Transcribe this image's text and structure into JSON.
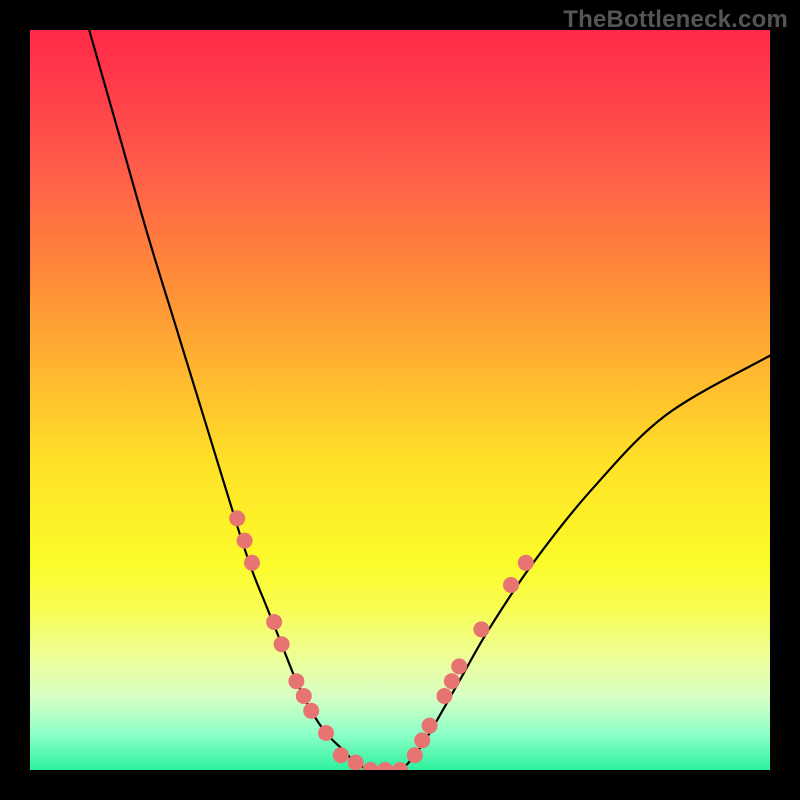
{
  "watermark": "TheBottleneck.com",
  "colors": {
    "background": "#000000",
    "dot": "#e77470",
    "curve": "#000000"
  },
  "chart_data": {
    "type": "line",
    "title": "",
    "xlabel": "",
    "ylabel": "",
    "xlim": [
      0,
      100
    ],
    "ylim": [
      0,
      100
    ],
    "grid": false,
    "legend": false,
    "series": [
      {
        "name": "bottleneck-curve",
        "x": [
          8,
          12,
          16,
          20,
          24,
          28,
          30,
          32,
          34,
          36,
          38,
          40,
          42,
          44,
          46,
          48,
          50,
          52,
          54,
          58,
          62,
          68,
          76,
          86,
          100
        ],
        "values": [
          100,
          86,
          72,
          59,
          46,
          33,
          27,
          22,
          17,
          12,
          8,
          5,
          3,
          1,
          0,
          0,
          0,
          2,
          5,
          12,
          19,
          28,
          38,
          48,
          56
        ]
      }
    ],
    "annotations": {
      "scatter_points": [
        {
          "x": 28,
          "y": 34
        },
        {
          "x": 29,
          "y": 31
        },
        {
          "x": 30,
          "y": 28
        },
        {
          "x": 33,
          "y": 20
        },
        {
          "x": 34,
          "y": 17
        },
        {
          "x": 36,
          "y": 12
        },
        {
          "x": 37,
          "y": 10
        },
        {
          "x": 38,
          "y": 8
        },
        {
          "x": 40,
          "y": 5
        },
        {
          "x": 42,
          "y": 2
        },
        {
          "x": 44,
          "y": 1
        },
        {
          "x": 46,
          "y": 0
        },
        {
          "x": 48,
          "y": 0
        },
        {
          "x": 50,
          "y": 0
        },
        {
          "x": 52,
          "y": 2
        },
        {
          "x": 53,
          "y": 4
        },
        {
          "x": 54,
          "y": 6
        },
        {
          "x": 56,
          "y": 10
        },
        {
          "x": 57,
          "y": 12
        },
        {
          "x": 58,
          "y": 14
        },
        {
          "x": 61,
          "y": 19
        },
        {
          "x": 65,
          "y": 25
        },
        {
          "x": 67,
          "y": 28
        }
      ]
    },
    "gradient_background": {
      "type": "vertical",
      "stops": [
        {
          "pos": 0,
          "color": "#ff2a48"
        },
        {
          "pos": 50,
          "color": "#ffd028"
        },
        {
          "pos": 80,
          "color": "#fbfb2a"
        },
        {
          "pos": 100,
          "color": "#2cf29e"
        }
      ]
    }
  }
}
